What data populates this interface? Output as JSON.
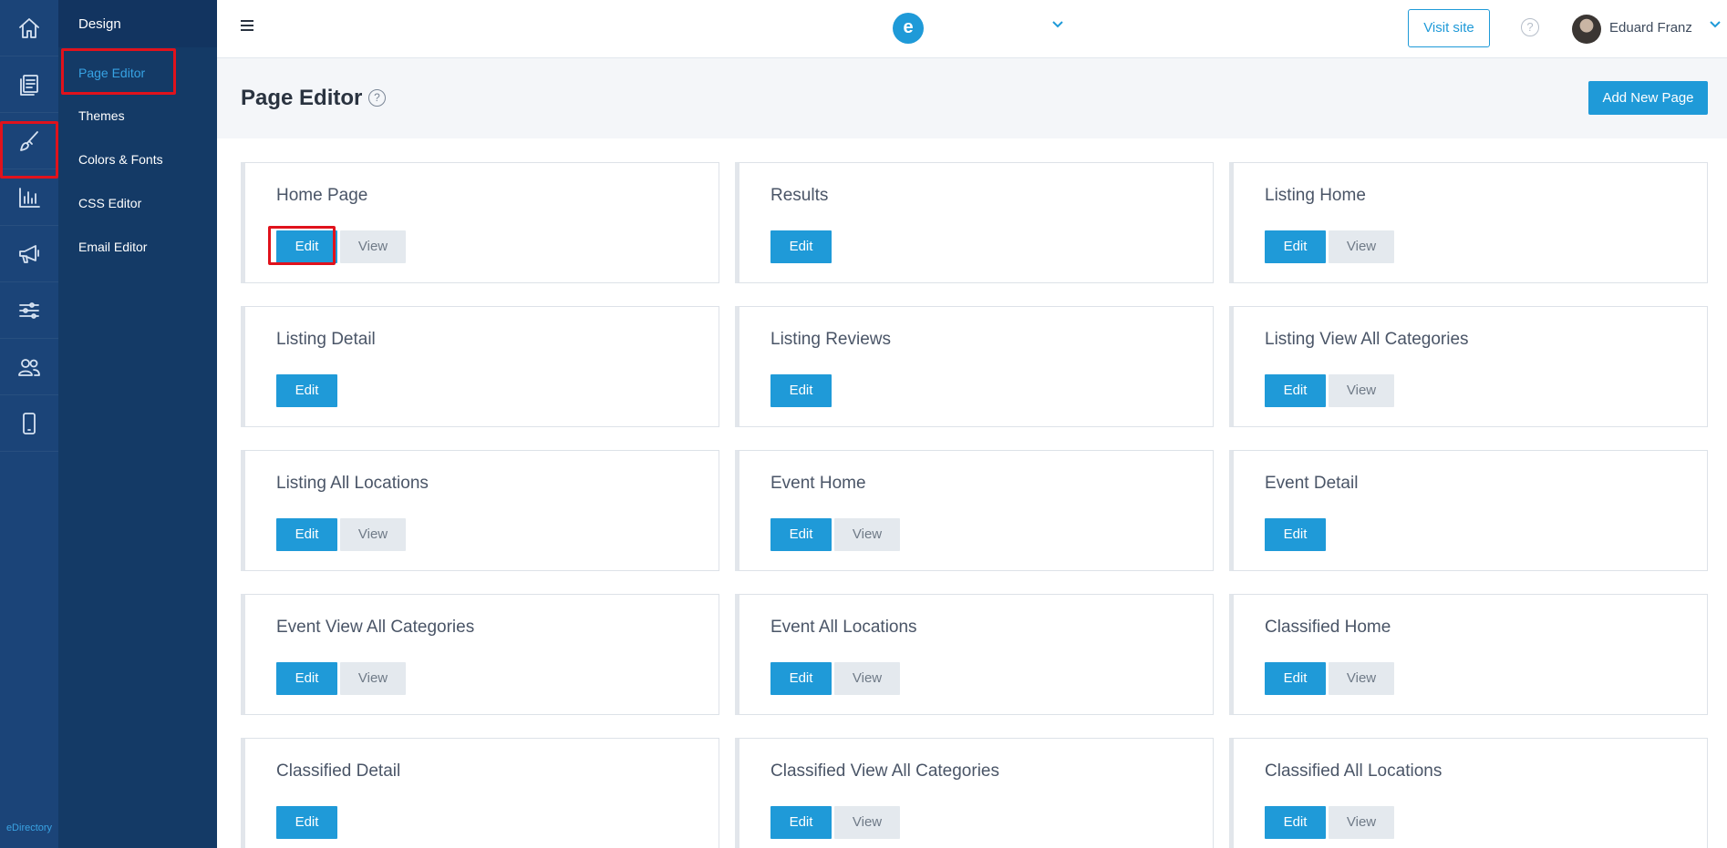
{
  "rail": {
    "items": [
      {
        "icon": "home-icon"
      },
      {
        "icon": "pages-icon"
      },
      {
        "icon": "brush-icon"
      },
      {
        "icon": "chart-icon"
      },
      {
        "icon": "megaphone-icon"
      },
      {
        "icon": "sliders-icon"
      },
      {
        "icon": "users-icon"
      },
      {
        "icon": "mobile-icon"
      }
    ],
    "brand": "eDirectory"
  },
  "submenu": {
    "heading": "Design",
    "items": [
      "Page Editor",
      "Themes",
      "Colors & Fonts",
      "CSS Editor",
      "Email Editor"
    ],
    "active": "Page Editor"
  },
  "topbar": {
    "logo_letter": "e",
    "visit_label": "Visit site",
    "help_label": "?",
    "user_name": "Eduard Franz"
  },
  "header": {
    "title": "Page Editor",
    "help_label": "?",
    "add_label": "Add New Page"
  },
  "buttons": {
    "edit": "Edit",
    "view": "View"
  },
  "pages": [
    {
      "title": "Home Page",
      "has_view": true
    },
    {
      "title": "Results",
      "has_view": false
    },
    {
      "title": "Listing Home",
      "has_view": true
    },
    {
      "title": "Listing Detail",
      "has_view": false
    },
    {
      "title": "Listing Reviews",
      "has_view": false
    },
    {
      "title": "Listing View All Categories",
      "has_view": true
    },
    {
      "title": "Listing All Locations",
      "has_view": true
    },
    {
      "title": "Event Home",
      "has_view": true
    },
    {
      "title": "Event Detail",
      "has_view": false
    },
    {
      "title": "Event View All Categories",
      "has_view": true
    },
    {
      "title": "Event All Locations",
      "has_view": true
    },
    {
      "title": "Classified Home",
      "has_view": true
    },
    {
      "title": "Classified Detail",
      "has_view": false
    },
    {
      "title": "Classified View All Categories",
      "has_view": true
    },
    {
      "title": "Classified All Locations",
      "has_view": true
    }
  ],
  "colors": {
    "rail": "#1b4478",
    "submenu": "#143a66",
    "accent": "#1f9ad8",
    "highlight": "#e0121c"
  }
}
